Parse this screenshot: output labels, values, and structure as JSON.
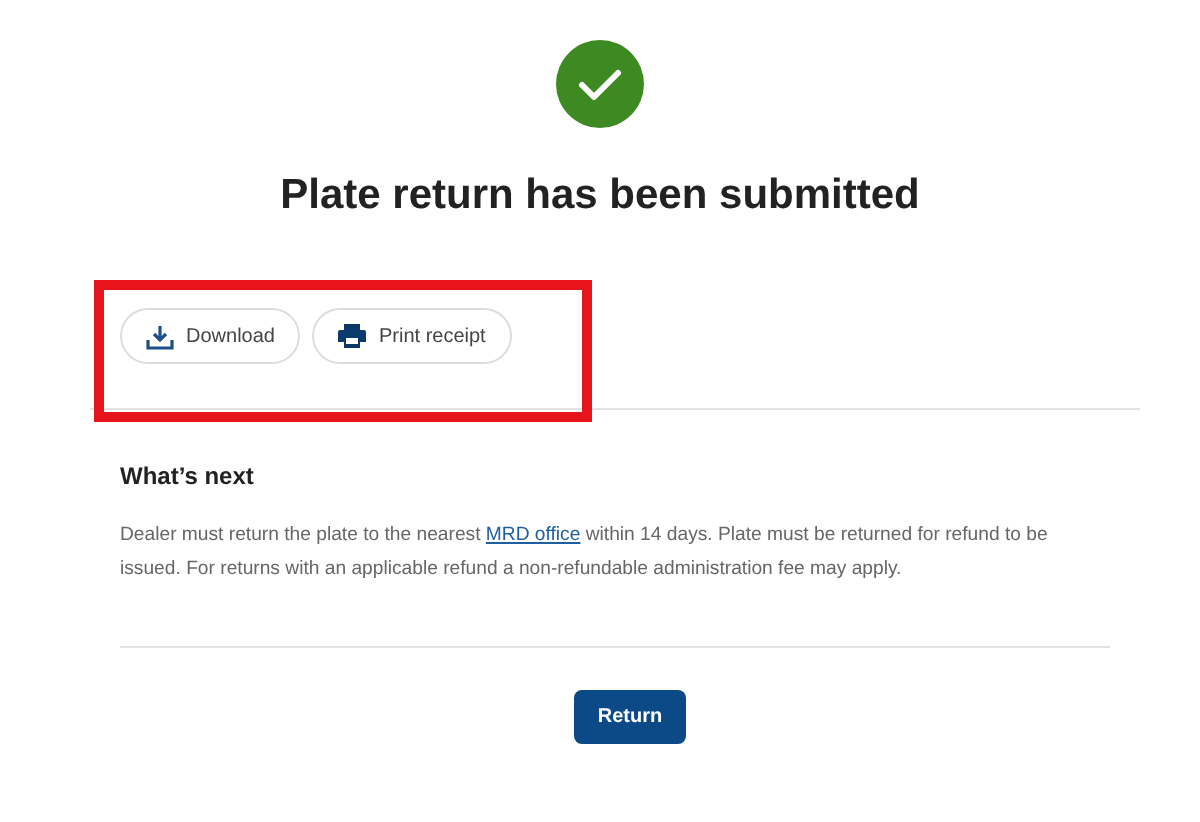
{
  "title": "Plate return has been submitted",
  "actions": [
    {
      "kind": "download",
      "label": "Download"
    },
    {
      "kind": "print",
      "label": "Print receipt"
    }
  ],
  "next": {
    "heading": "What’s next",
    "before_link": "Dealer must return the plate to the nearest",
    "link": "MRD office",
    "after_link": "within 14 days. Plate must be returned for refund to be issued. For returns with an applicable refund a non-refundable administration fee may apply."
  },
  "return_button": "Return"
}
